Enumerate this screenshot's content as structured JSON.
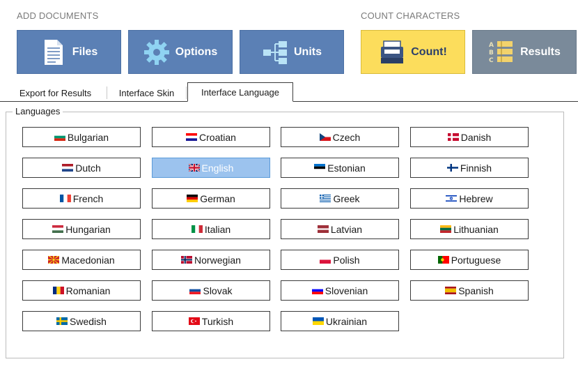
{
  "header": {
    "add_documents_label": "ADD DOCUMENTS",
    "count_characters_label": "COUNT CHARACTERS"
  },
  "toolbar": {
    "files_label": "Files",
    "options_label": "Options",
    "units_label": "Units",
    "count_label": "Count!",
    "results_label": "Results"
  },
  "tabs": [
    {
      "label": "Export  for Results"
    },
    {
      "label": "Interface Skin"
    },
    {
      "label": "Interface Language",
      "active": true
    }
  ],
  "languages_group": {
    "title": "Languages",
    "selected": "English",
    "items": [
      {
        "label": "Bulgarian",
        "flag": [
          "#ffffff",
          "#00966e",
          "#d62612"
        ],
        "dir": "h"
      },
      {
        "label": "Croatian",
        "flag": [
          "#ff0000",
          "#ffffff",
          "#171796"
        ],
        "dir": "h"
      },
      {
        "label": "Czech",
        "flag": [
          "#ffffff",
          "#d7141a",
          "#11457e"
        ],
        "dir": "czech"
      },
      {
        "label": "Danish",
        "flag": [
          "#c60c30",
          "#ffffff"
        ],
        "dir": "nordic"
      },
      {
        "label": "Dutch",
        "flag": [
          "#ae1c28",
          "#ffffff",
          "#21468b"
        ],
        "dir": "h"
      },
      {
        "label": "English",
        "flag": [
          "#012169",
          "#ffffff",
          "#c8102e"
        ],
        "dir": "uk"
      },
      {
        "label": "Estonian",
        "flag": [
          "#0072ce",
          "#000000",
          "#ffffff"
        ],
        "dir": "h"
      },
      {
        "label": "Finnish",
        "flag": [
          "#ffffff",
          "#003580"
        ],
        "dir": "nordic"
      },
      {
        "label": "French",
        "flag": [
          "#0055a4",
          "#ffffff",
          "#ef4135"
        ],
        "dir": "v"
      },
      {
        "label": "German",
        "flag": [
          "#000000",
          "#dd0000",
          "#ffce00"
        ],
        "dir": "h"
      },
      {
        "label": "Greek",
        "flag": [
          "#0d5eaf",
          "#ffffff"
        ],
        "dir": "stripes"
      },
      {
        "label": "Hebrew",
        "flag": [
          "#ffffff",
          "#0038b8"
        ],
        "dir": "israel"
      },
      {
        "label": "Hungarian",
        "flag": [
          "#cd2a3e",
          "#ffffff",
          "#436f4d"
        ],
        "dir": "h"
      },
      {
        "label": "Italian",
        "flag": [
          "#009246",
          "#ffffff",
          "#ce2b37"
        ],
        "dir": "v"
      },
      {
        "label": "Latvian",
        "flag": [
          "#9e3039",
          "#ffffff",
          "#9e3039"
        ],
        "dir": "latvia"
      },
      {
        "label": "Lithuanian",
        "flag": [
          "#fdb913",
          "#006a44",
          "#c1272d"
        ],
        "dir": "h"
      },
      {
        "label": "Macedonian",
        "flag": [
          "#ce2028",
          "#f9d616"
        ],
        "dir": "sun"
      },
      {
        "label": "Norwegian",
        "flag": [
          "#ba0c2f",
          "#ffffff",
          "#00205b"
        ],
        "dir": "nordic3"
      },
      {
        "label": "Polish",
        "flag": [
          "#ffffff",
          "#dc143c"
        ],
        "dir": "h2"
      },
      {
        "label": "Portuguese",
        "flag": [
          "#006600",
          "#ff0000"
        ],
        "dir": "portugal"
      },
      {
        "label": "Romanian",
        "flag": [
          "#002b7f",
          "#fcd116",
          "#ce1126"
        ],
        "dir": "v"
      },
      {
        "label": "Slovak",
        "flag": [
          "#ffffff",
          "#0b4ea2",
          "#ee1c25"
        ],
        "dir": "h"
      },
      {
        "label": "Slovenian",
        "flag": [
          "#ffffff",
          "#0000ff",
          "#ff0000"
        ],
        "dir": "h"
      },
      {
        "label": "Spanish",
        "flag": [
          "#aa151b",
          "#f1bf00",
          "#aa151b"
        ],
        "dir": "spain"
      },
      {
        "label": "Swedish",
        "flag": [
          "#006aa7",
          "#fecc00"
        ],
        "dir": "nordic"
      },
      {
        "label": "Turkish",
        "flag": [
          "#e30a17",
          "#ffffff"
        ],
        "dir": "turkey"
      },
      {
        "label": "Ukrainian",
        "flag": [
          "#0057b7",
          "#ffd700"
        ],
        "dir": "h2"
      }
    ]
  }
}
